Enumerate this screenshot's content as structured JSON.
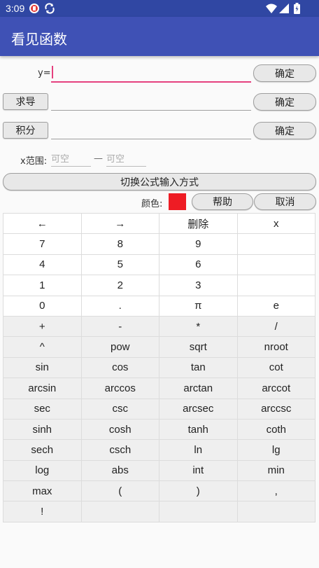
{
  "status_bar": {
    "time": "3:09"
  },
  "app_bar": {
    "title": "看见函数"
  },
  "y_row": {
    "label": "y=",
    "confirm": "确定"
  },
  "derivative_row": {
    "button": "求导",
    "confirm": "确定"
  },
  "integral_row": {
    "button": "积分",
    "confirm": "确定"
  },
  "x_range": {
    "label": "x范围:",
    "from_placeholder": "可空",
    "dash": "—",
    "to_placeholder": "可空"
  },
  "switch_input": "切换公式输入方式",
  "color_row": {
    "label": "颜色:",
    "color": "#ee1c24",
    "help": "帮助",
    "cancel": "取消"
  },
  "accent_color": "#3f51b5",
  "keypad": {
    "rows": [
      {
        "style": "white",
        "keys": [
          "←",
          "→",
          "删除",
          "x"
        ]
      },
      {
        "style": "white",
        "keys": [
          "7",
          "8",
          "9",
          ""
        ]
      },
      {
        "style": "white",
        "keys": [
          "4",
          "5",
          "6",
          ""
        ]
      },
      {
        "style": "white",
        "keys": [
          "1",
          "2",
          "3",
          ""
        ]
      },
      {
        "style": "white",
        "keys": [
          "0",
          ".",
          "π",
          "e"
        ]
      },
      {
        "style": "gray",
        "keys": [
          "+",
          "-",
          "*",
          "/"
        ]
      },
      {
        "style": "gray",
        "keys": [
          "^",
          "pow",
          "sqrt",
          "nroot"
        ]
      },
      {
        "style": "gray",
        "keys": [
          "sin",
          "cos",
          "tan",
          "cot"
        ]
      },
      {
        "style": "gray",
        "keys": [
          "arcsin",
          "arccos",
          "arctan",
          "arccot"
        ]
      },
      {
        "style": "gray",
        "keys": [
          "sec",
          "csc",
          "arcsec",
          "arccsc"
        ]
      },
      {
        "style": "gray",
        "keys": [
          "sinh",
          "cosh",
          "tanh",
          "coth"
        ]
      },
      {
        "style": "gray",
        "keys": [
          "sech",
          "csch",
          "ln",
          "lg"
        ]
      },
      {
        "style": "gray",
        "keys": [
          "log",
          "abs",
          "int",
          "min"
        ]
      },
      {
        "style": "gray",
        "keys": [
          "max",
          "(",
          ")",
          ","
        ]
      },
      {
        "style": "gray",
        "keys": [
          "!",
          "",
          "",
          ""
        ]
      }
    ]
  }
}
